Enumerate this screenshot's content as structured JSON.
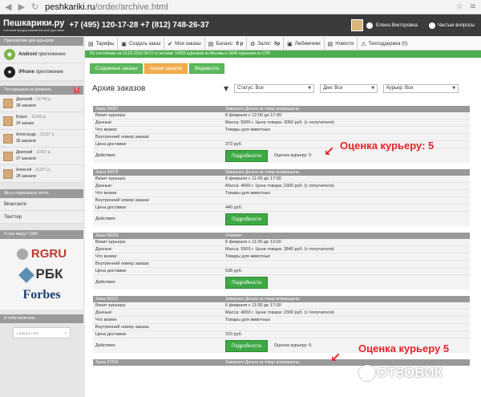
{
  "browser": {
    "url_host": "peshkariki.ru",
    "url_path": "/order/archive.html"
  },
  "header": {
    "logo": "Пешкарики.ру",
    "tagline": "Система предпринимательской доставки",
    "phones": "+7 (495) 120-17-28 +7 (812) 748-26-37",
    "user_name": "Елена Викторовна",
    "faq": "Частые вопросы"
  },
  "sidebar": {
    "apps_title": "Приложение для курьеров",
    "apps": [
      {
        "name": "Android",
        "suffix": "приложение"
      },
      {
        "name": "iPhone",
        "suffix": "приложение"
      }
    ],
    "top_title": "Топ курьеров за февраль",
    "top_badge": "5",
    "top": [
      {
        "name": "Дмитрий",
        "value": "- 12745 р.",
        "orders": "38 заказов"
      },
      {
        "name": "Борис",
        "value": "- 11660 р.",
        "orders": "24 заказа"
      },
      {
        "name": "Александр",
        "value": "- 11637 р.",
        "orders": "36 заказов"
      },
      {
        "name": "Дмитрий",
        "value": "- 11667 р.",
        "orders": "37 заказов"
      },
      {
        "name": "Алексей",
        "value": "- 11297 р.",
        "orders": "28 заказов"
      }
    ],
    "social_title": "Мы в социальных сетях",
    "social": [
      "Вконтакте",
      "Твиттер"
    ],
    "press_title": "О нас пишут СМИ",
    "press": [
      "RGRU",
      "РБК",
      "Forbes"
    ],
    "read_title": "И тебя почитали",
    "read_box": "L A W & L I F E"
  },
  "tabs": [
    {
      "icon": "▤",
      "label": "Тарифы"
    },
    {
      "icon": "▣",
      "label": "Создать заказ"
    },
    {
      "icon": "✔",
      "label": "Мои заказы"
    },
    {
      "icon": "▤",
      "label": "Баланс:",
      "bold": "0 р"
    },
    {
      "icon": "⚙",
      "label": "Залог:",
      "bold": "0р"
    },
    {
      "icon": "▣",
      "label": "Любимчики"
    },
    {
      "icon": "▤",
      "label": "Новости"
    },
    {
      "icon": "⚠",
      "label": "Техподдержка (0)"
    }
  ],
  "status_line": "По состоянию на 10.02.2016 04:27 в системе 14355 курьеров из Москвы и 3646 курьеров из СПб",
  "subtabs": [
    "Созданные заказы",
    "Архив заказов",
    "Ведомость"
  ],
  "page_title": "Архив заказов",
  "filters": {
    "status": "Статус: Все",
    "days": "Дни: Все",
    "courier": "Курьер: Все"
  },
  "labels": {
    "visit": "Визит курьера:",
    "data": "Данные:",
    "carry": "Что везем:",
    "internal": "Внутренний номер заказа:",
    "price": "Цена доставки:",
    "actions": "Действия:",
    "details": "Подробности"
  },
  "orders": [
    {
      "id": "Заказ 99097",
      "status": "Завершен Деньги за товар возвращены",
      "visit": "8 февраля с 12:00 до 17:00",
      "data": "Масса: 5000 г. Цена товара: 3050 руб. (с получателя)",
      "carry": "Товары для животных",
      "price": "373 руб.",
      "rating": "Оценка курьеру: 5"
    },
    {
      "id": "Заказ 98878",
      "status": "Завершен Деньги за товар возвращены",
      "visit": "8 февраля с 11:00 до 17:00",
      "data": "Масса: 4000 г. Цена товара: 2300 руб. (с получателя)",
      "carry": "Товары для животных",
      "price": "440 руб.",
      "rating": ""
    },
    {
      "id": "Заказ 98328",
      "status": "Отменен",
      "visit": "8 февраля с 11:00 до 12:00",
      "data": "Масса: 5500 г. Цена товара: 3840 руб. (с получателя)",
      "carry": "Товары для животных",
      "price": "538 руб.",
      "rating": ""
    },
    {
      "id": "Заказ 98321",
      "status": "Завершен Деньги за товар возвращены",
      "visit": "6 февраля с 11:00 до 17:00",
      "data": "Масса: 4000 г. Цена товара: 2300 руб. (с получателя)",
      "carry": "Товары для животных",
      "price": "310 руб.",
      "rating": "Оценка курьеру: 5"
    },
    {
      "id": "Заказ 97814",
      "status": "Завершен Деньги за товар возвращены",
      "visit": "",
      "data": "",
      "carry": "",
      "price": "",
      "rating": ""
    }
  ],
  "annotations": [
    "Оценка курьеру: 5",
    "Оценка курьеру 5"
  ],
  "watermark": "ОТЗОВИК"
}
